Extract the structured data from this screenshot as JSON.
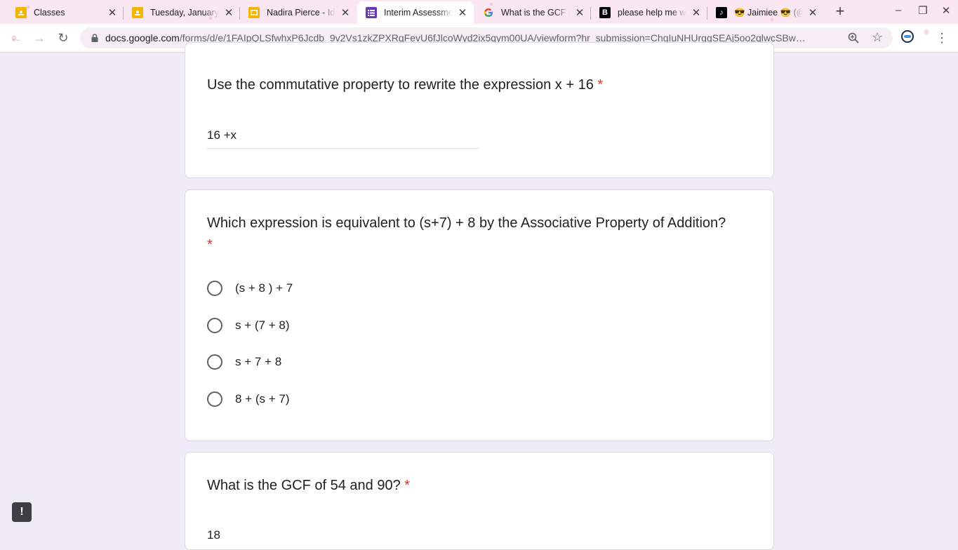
{
  "tabs": [
    {
      "title": "Classes",
      "favicon": "google-classroom-icon"
    },
    {
      "title": "Tuesday, January",
      "favicon": "google-classroom-icon"
    },
    {
      "title": "Nadira Pierce - Idi",
      "favicon": "google-slides-icon"
    },
    {
      "title": "Interim Assessme",
      "favicon": "google-forms-icon",
      "active": true
    },
    {
      "title": "What is the GCF o",
      "favicon": "google-icon"
    },
    {
      "title": "please help me w",
      "favicon": "brainly-icon"
    },
    {
      "title": "😎 Jaimiee 😎 (@",
      "favicon": "tiktok-icon"
    }
  ],
  "window_controls": {
    "minimize": "–",
    "maximize": "❐",
    "close": "✕"
  },
  "address_bar": {
    "host": "docs.google.com",
    "path": "/forms/d/e/1FAIpQLSfwhxP6Jcdb_9v2Vs1zkZPXRqFevU6fJlcoWyd2ix5qym00UA/viewform?hr_submission=ChgIuNHUrggSEAj5oo2qlwcSBw…"
  },
  "questions": [
    {
      "title": "Use the commutative property to rewrite the expression x + 16",
      "required_mark": "*",
      "answer": "16 +x"
    },
    {
      "title": "Which expression is equivalent to (s+7) + 8 by the Associative Property of Addition?",
      "required_mark": "*",
      "options": [
        "(s + 8 ) + 7",
        "s + (7 + 8)",
        "s + 7 + 8",
        "8 + (s + 7)"
      ]
    },
    {
      "title": "What is the GCF of 54 and 90?",
      "required_mark": "*",
      "answer": "18"
    }
  ],
  "report_button": "!",
  "colors": {
    "background": "#f0ebf8",
    "required": "#d93025",
    "forms_purple": "#673ab7"
  }
}
